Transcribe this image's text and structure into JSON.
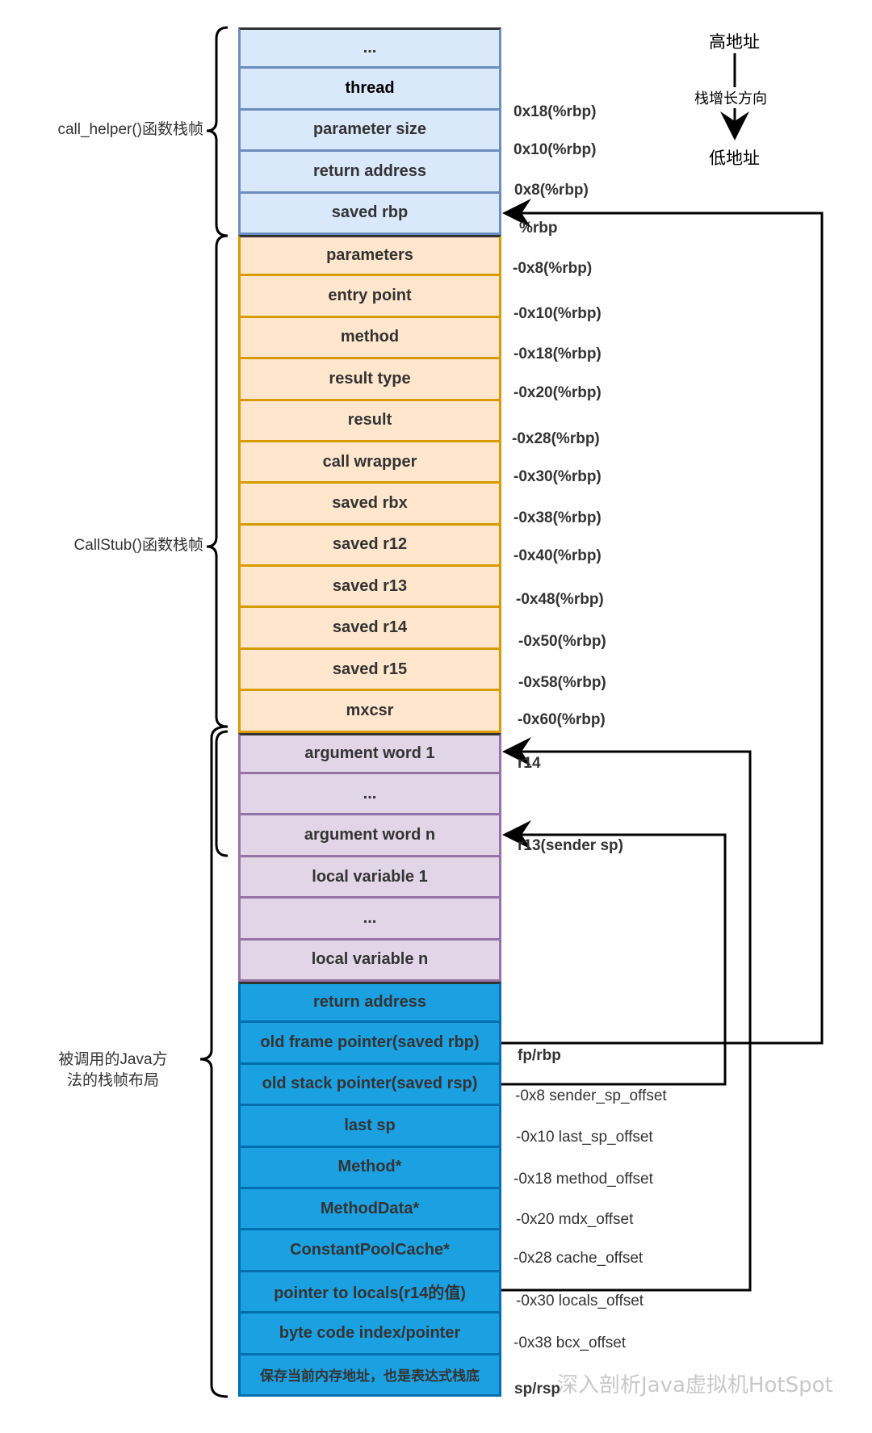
{
  "legend": {
    "high": "高地址",
    "direction": "栈增长方向",
    "low": "低地址"
  },
  "groups": [
    {
      "label": "call_helper()函数栈帧"
    },
    {
      "label": "CallStub()函数栈帧"
    },
    {
      "label": "被调用的Java方\n法的栈帧布局"
    }
  ],
  "stack": [
    {
      "label": "...",
      "group": "blue"
    },
    {
      "label": "thread",
      "group": "blue"
    },
    {
      "label": "parameter size",
      "group": "blue"
    },
    {
      "label": "return address",
      "group": "blue"
    },
    {
      "label": "saved rbp",
      "group": "blue"
    },
    {
      "label": "parameters",
      "group": "orange"
    },
    {
      "label": "entry point",
      "group": "orange"
    },
    {
      "label": "method",
      "group": "orange"
    },
    {
      "label": "result type",
      "group": "orange"
    },
    {
      "label": "result",
      "group": "orange"
    },
    {
      "label": "call wrapper",
      "group": "orange"
    },
    {
      "label": "saved rbx",
      "group": "orange"
    },
    {
      "label": "saved r12",
      "group": "orange"
    },
    {
      "label": "saved r13",
      "group": "orange"
    },
    {
      "label": "saved r14",
      "group": "orange"
    },
    {
      "label": "saved r15",
      "group": "orange"
    },
    {
      "label": "mxcsr",
      "group": "orange"
    },
    {
      "label": "argument word 1",
      "group": "purple"
    },
    {
      "label": "...",
      "group": "purple"
    },
    {
      "label": "argument word n",
      "group": "purple"
    },
    {
      "label": "local variable 1",
      "group": "purple"
    },
    {
      "label": "...",
      "group": "purple"
    },
    {
      "label": "local variable n",
      "group": "purple"
    },
    {
      "label": "return address",
      "group": "java"
    },
    {
      "label": "old frame pointer(saved rbp)",
      "group": "java"
    },
    {
      "label": "old stack pointer(saved rsp)",
      "group": "java"
    },
    {
      "label": "last sp",
      "group": "java"
    },
    {
      "label": "Method*",
      "group": "java"
    },
    {
      "label": "MethodData*",
      "group": "java"
    },
    {
      "label": "ConstantPoolCache*",
      "group": "java"
    },
    {
      "label": "pointer to locals(r14的值)",
      "group": "java"
    },
    {
      "label": "byte code index/pointer",
      "group": "java"
    },
    {
      "label": "保存当前内存地址，也是表达式栈底",
      "group": "java"
    }
  ],
  "offsets": [
    {
      "text": "0x18(%rbp)",
      "bold": true
    },
    {
      "text": "0x10(%rbp)",
      "bold": true
    },
    {
      "text": "0x8(%rbp)",
      "bold": true
    },
    {
      "text": "%rbp",
      "bold": true
    },
    {
      "text": "-0x8(%rbp)",
      "bold": true
    },
    {
      "text": "-0x10(%rbp)",
      "bold": true
    },
    {
      "text": "-0x18(%rbp)",
      "bold": true
    },
    {
      "text": "-0x20(%rbp)",
      "bold": true
    },
    {
      "text": "-0x28(%rbp)",
      "bold": true
    },
    {
      "text": "-0x30(%rbp)",
      "bold": true
    },
    {
      "text": "-0x38(%rbp)",
      "bold": true
    },
    {
      "text": "-0x40(%rbp)",
      "bold": true
    },
    {
      "text": "-0x48(%rbp)",
      "bold": true
    },
    {
      "text": "-0x50(%rbp)",
      "bold": true
    },
    {
      "text": "-0x58(%rbp)",
      "bold": true
    },
    {
      "text": "-0x60(%rbp)",
      "bold": true
    },
    {
      "text": "r14",
      "bold": true
    },
    {
      "text": "r13(sender sp)",
      "bold": true
    },
    {
      "text": "fp/rbp",
      "bold": true
    },
    {
      "text": "-0x8  sender_sp_offset",
      "bold": false
    },
    {
      "text": "-0x10 last_sp_offset",
      "bold": false
    },
    {
      "text": "-0x18 method_offset",
      "bold": false
    },
    {
      "text": "-0x20 mdx_offset",
      "bold": false
    },
    {
      "text": "-0x28 cache_offset",
      "bold": false
    },
    {
      "text": "-0x30 locals_offset",
      "bold": false
    },
    {
      "text": "-0x38 bcx_offset",
      "bold": false
    },
    {
      "text": "sp/rsp",
      "bold": true
    }
  ],
  "watermark": "深入剖析Java虚拟机HotSpot"
}
